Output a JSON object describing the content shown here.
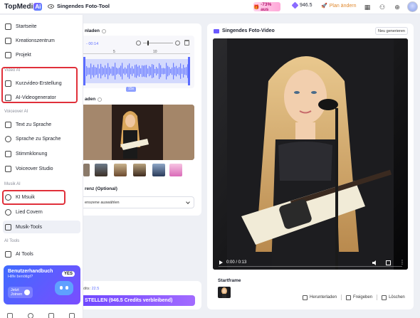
{
  "header": {
    "brand": "TopMedi",
    "brand_ai": "Ai",
    "tool_title": "Singendes Foto-Tool",
    "promo": "-73% aus",
    "credits": "946.5",
    "plan_label": "Plan ändern"
  },
  "sidebar": {
    "items": [
      {
        "label": "Startseite",
        "icon": "home-icon"
      },
      {
        "label": "Kreationszentrum",
        "icon": "folder-icon"
      },
      {
        "label": "Projekt",
        "icon": "project-icon"
      }
    ],
    "sections": [
      {
        "label": "Video AI",
        "items": [
          {
            "label": "Kurzvideo-Erstellung",
            "icon": "short-video-icon"
          },
          {
            "label": "AI-Videogenerator",
            "icon": "video-generator-icon"
          }
        ]
      },
      {
        "label": "Voiceover AI",
        "items": [
          {
            "label": "Text zu Sprache",
            "icon": "text-to-speech-icon"
          },
          {
            "label": "Sprache zu Sprache",
            "icon": "speech-to-speech-icon"
          },
          {
            "label": "Stimmklonung",
            "icon": "voice-clone-icon"
          },
          {
            "label": "Voiceover Studio",
            "icon": "voiceover-studio-icon"
          }
        ]
      },
      {
        "label": "Musik AI",
        "items": [
          {
            "label": "KI Msuik",
            "icon": "music-icon"
          },
          {
            "label": "Lied Covern",
            "icon": "cover-icon"
          },
          {
            "label": "Musik-Tools",
            "icon": "music-tools-icon"
          }
        ]
      },
      {
        "label": "AI Tools",
        "items": [
          {
            "label": "AI Tools",
            "icon": "tools-icon"
          }
        ]
      }
    ],
    "promo_card": {
      "title": "Benutzerhandbuch",
      "subtitle": "Hilfe benötigt?",
      "button": "Jetzt\nJoinen",
      "badge": "YES"
    }
  },
  "middle": {
    "audio_label": "nladen",
    "audio_time": "- 00:14",
    "ruler": [
      "5",
      "10"
    ],
    "duration_badge": "15s",
    "image_label": "aden",
    "reference_label": "renz (Optional)",
    "reference_placeholder": "enszene auswählen",
    "credits_prefix": "dits: ",
    "credits_value": "22.5",
    "create_button": "STELLEN (946.5 Credits verbleibend)"
  },
  "right": {
    "title": "Singendes Foto-Video",
    "regenerate": "Neu generieren",
    "video_time": "0:00 / 0:13",
    "start_frame": "Startframe",
    "actions": [
      "Herunterladen",
      "Freigeben",
      "Löschen"
    ]
  },
  "colors": {
    "accent": "#7048ff",
    "highlight": "#e0303a"
  }
}
